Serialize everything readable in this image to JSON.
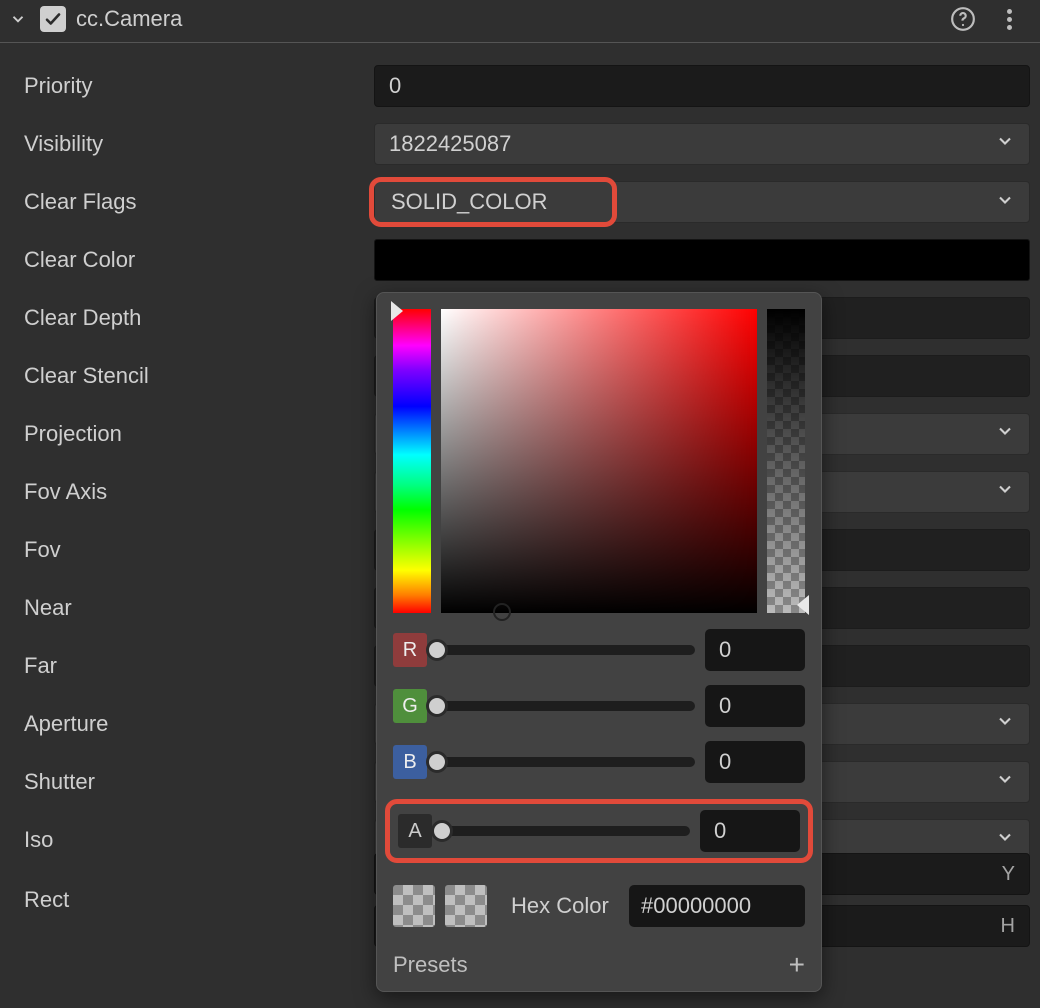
{
  "header": {
    "title": "cc.Camera",
    "checked": true
  },
  "props": {
    "priority": {
      "label": "Priority",
      "value": "0"
    },
    "visibility": {
      "label": "Visibility",
      "value": "1822425087"
    },
    "clearFlags": {
      "label": "Clear Flags",
      "value": "SOLID_COLOR"
    },
    "clearColor": {
      "label": "Clear Color"
    },
    "clearDepth": {
      "label": "Clear Depth"
    },
    "clearStencil": {
      "label": "Clear Stencil"
    },
    "projection": {
      "label": "Projection"
    },
    "fovAxis": {
      "label": "Fov Axis"
    },
    "fov": {
      "label": "Fov"
    },
    "near": {
      "label": "Near"
    },
    "far": {
      "label": "Far"
    },
    "aperture": {
      "label": "Aperture"
    },
    "shutter": {
      "label": "Shutter"
    },
    "iso": {
      "label": "Iso"
    },
    "rect": {
      "label": "Rect",
      "suffixY": "Y",
      "suffixH": "H"
    }
  },
  "colorPicker": {
    "r": {
      "label": "R",
      "value": "0"
    },
    "g": {
      "label": "G",
      "value": "0"
    },
    "b": {
      "label": "B",
      "value": "0"
    },
    "a": {
      "label": "A",
      "value": "0"
    },
    "hexLabel": "Hex Color",
    "hex": "#00000000",
    "presetsLabel": "Presets"
  }
}
